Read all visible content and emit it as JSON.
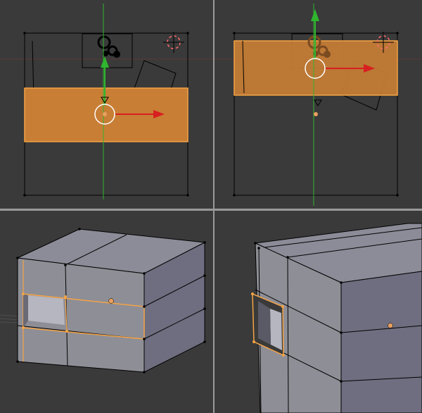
{
  "colors": {
    "viewport_bg": "#3a3a3a",
    "separator": "#9a9a9a",
    "wire": "#000000",
    "selected_face": "#c87e35",
    "selected_edge": "#f5a445",
    "axis_x": "#d82020",
    "axis_y": "#2fb52f",
    "cursor_red": "#ff6b6b",
    "origin_dot": "#e8a060",
    "cube_top": "#8c8c98",
    "cube_front": "#8e8e96",
    "cube_side": "#6e6e80"
  },
  "viewports": [
    {
      "name": "top-left",
      "view": "orthographic",
      "state": "loop-cut-selected-middle"
    },
    {
      "name": "top-right",
      "view": "orthographic",
      "state": "loop-cut-selected-moved-up"
    },
    {
      "name": "bottom-left",
      "view": "perspective",
      "state": "cube-loop-selected"
    },
    {
      "name": "bottom-right",
      "view": "perspective",
      "state": "cube-face-selected"
    }
  ],
  "icons": {
    "cursor": "3d-cursor-icon",
    "camera": "camera-icon",
    "lamp": "lamp-icon",
    "manipulator": "transform-manipulator-icon"
  }
}
